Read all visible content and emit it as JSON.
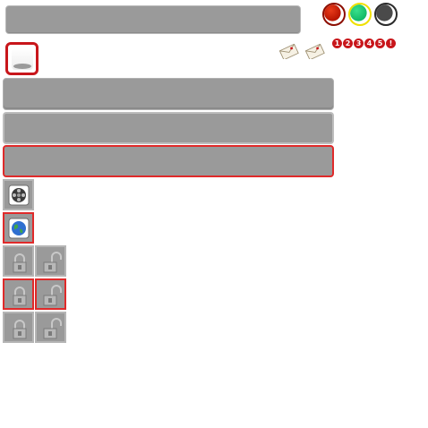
{
  "colors": {
    "panel": "#9a9a9a",
    "accent": "#c8161b",
    "selection": "#e02a2a",
    "traffic_red": "#cc1c00",
    "traffic_green": "#1ed17a",
    "traffic_dark": "#4a4a4a"
  },
  "top_bar": {
    "value": ""
  },
  "status_dots": [
    {
      "name": "red",
      "icon": "red-circle"
    },
    {
      "name": "green",
      "icon": "green-circle"
    },
    {
      "name": "dark",
      "icon": "dark-circle"
    }
  ],
  "toggle": {
    "icon": "pill-icon",
    "state": "selected"
  },
  "mail_icons": [
    "envelope-icon",
    "envelope-icon"
  ],
  "number_chips": [
    "1",
    "2",
    "3",
    "4",
    "5",
    "!"
  ],
  "bars": [
    {
      "value": "",
      "state": "normal"
    },
    {
      "value": "",
      "state": "normal"
    },
    {
      "value": "",
      "state": "selected"
    }
  ],
  "icon_tiles": {
    "row1": {
      "icon": "film-reel-icon",
      "state": "normal"
    },
    "row2": {
      "icon": "globe-icon",
      "state": "selected"
    },
    "lock_rows": [
      [
        {
          "icon": "lock-closed-icon",
          "state": "normal"
        },
        {
          "icon": "lock-open-icon",
          "state": "normal"
        }
      ],
      [
        {
          "icon": "lock-closed-icon",
          "state": "selected"
        },
        {
          "icon": "lock-open-icon",
          "state": "selected"
        }
      ],
      [
        {
          "icon": "lock-closed-icon",
          "state": "normal"
        },
        {
          "icon": "lock-open-icon",
          "state": "normal"
        }
      ]
    ]
  }
}
